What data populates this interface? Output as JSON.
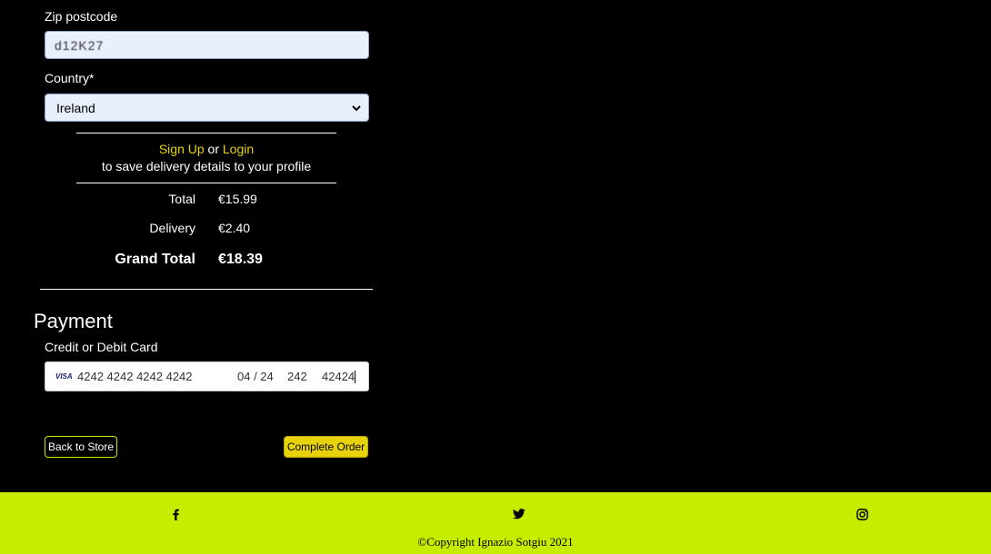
{
  "delivery_form": {
    "zip_label": "Zip postcode",
    "zip_value": "d12K27",
    "country_label": "Country*",
    "country_value": "Ireland"
  },
  "auth_prompt": {
    "signup": "Sign Up",
    "or": "or",
    "login": "Login",
    "message": "to save delivery details to your profile"
  },
  "summary": {
    "total_label": "Total",
    "total_value": "€15.99",
    "delivery_label": "Delivery",
    "delivery_value": "€2.40",
    "grand_label": "Grand Total",
    "grand_value": "€18.39"
  },
  "payment": {
    "heading": "Payment",
    "card_label": "Credit or Debit Card",
    "card_brand": "VISA",
    "card_number": "4242 4242 4242 4242",
    "card_expiry": "04 / 24",
    "card_cvc": "242",
    "card_zip": "42424"
  },
  "buttons": {
    "back": "Back to Store",
    "complete": "Complete Order"
  },
  "footer": {
    "icons": [
      "facebook-icon",
      "twitter-icon",
      "instagram-icon"
    ],
    "copyright": "©Copyright Ignazio Sotgiu 2021"
  },
  "colors": {
    "accent_lime": "#c6ed00",
    "accent_yellow": "#e8d20c",
    "background": "#000000"
  }
}
